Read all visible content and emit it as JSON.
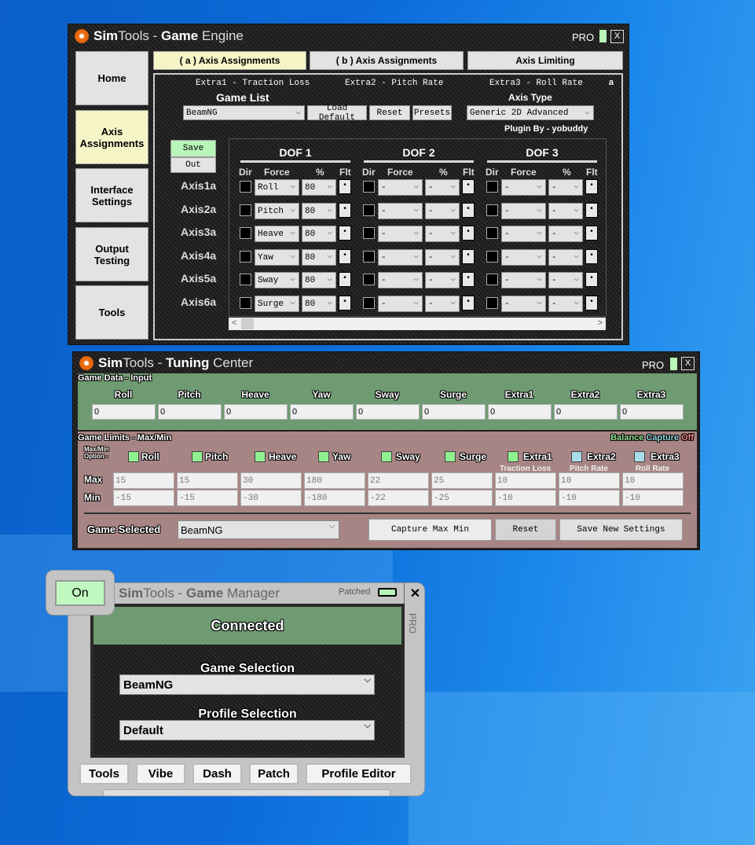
{
  "game_engine": {
    "title_bold1": "Sim",
    "title_reg1": "Tools - ",
    "title_bold2": "Game",
    "title_reg2": " Engine",
    "pro": "PRO",
    "close": "X",
    "sidebar": [
      {
        "label": "Home"
      },
      {
        "label": "Axis Assignments",
        "active": true
      },
      {
        "label": "Interface Settings"
      },
      {
        "label": "Output Testing"
      },
      {
        "label": "Tools"
      }
    ],
    "tabs": [
      {
        "label": "( a ) Axis Assignments",
        "active": true
      },
      {
        "label": "( b ) Axis Assignments"
      },
      {
        "label": "Axis Limiting"
      }
    ],
    "extras": [
      "Extra1 - Traction Loss",
      "Extra2 - Pitch Rate",
      "Extra3 - Roll Rate"
    ],
    "page_marker": "a",
    "game_list_label": "Game List",
    "game_list_value": "BeamNG",
    "load_default": "Load Default",
    "reset": "Reset",
    "presets": "Presets",
    "axis_type_label": "Axis Type",
    "axis_type_value": "Generic 2D Advanced",
    "plugin_by": "Plugin By - yobuddy",
    "save": "Save",
    "out": "Out",
    "dof_headers": [
      "DOF 1",
      "DOF 2",
      "DOF 3"
    ],
    "col_headers": {
      "dir": "Dir",
      "force": "Force",
      "pct": "%",
      "flt": "Flt"
    },
    "axes": [
      {
        "label": "Axis1a",
        "dof": [
          {
            "force": "Roll",
            "pct": "80"
          },
          {
            "force": "-",
            "pct": "-"
          },
          {
            "force": "-",
            "pct": "-"
          }
        ]
      },
      {
        "label": "Axis2a",
        "dof": [
          {
            "force": "Pitch",
            "pct": "80"
          },
          {
            "force": "-",
            "pct": "-"
          },
          {
            "force": "-",
            "pct": "-"
          }
        ]
      },
      {
        "label": "Axis3a",
        "dof": [
          {
            "force": "Heave",
            "pct": "80"
          },
          {
            "force": "-",
            "pct": "-"
          },
          {
            "force": "-",
            "pct": "-"
          }
        ]
      },
      {
        "label": "Axis4a",
        "dof": [
          {
            "force": "Yaw",
            "pct": "80"
          },
          {
            "force": "-",
            "pct": "-"
          },
          {
            "force": "-",
            "pct": "-"
          }
        ]
      },
      {
        "label": "Axis5a",
        "dof": [
          {
            "force": "Sway",
            "pct": "80"
          },
          {
            "force": "-",
            "pct": "-"
          },
          {
            "force": "-",
            "pct": "-"
          }
        ]
      },
      {
        "label": "Axis6a",
        "dof": [
          {
            "force": "Surge",
            "pct": "80"
          },
          {
            "force": "-",
            "pct": "-"
          },
          {
            "force": "-",
            "pct": "-"
          }
        ]
      }
    ],
    "flt_glyph": "•",
    "scroll_left": "<",
    "scroll_right": ">"
  },
  "tuning_center": {
    "title_bold1": "Sim",
    "title_reg1": "Tools - ",
    "title_bold2": "Tuning",
    "title_reg2": " Center",
    "pro": "PRO",
    "close": "X",
    "input_section": "Game Data - Input",
    "inputs": [
      {
        "label": "Roll",
        "value": "0"
      },
      {
        "label": "Pitch",
        "value": "0"
      },
      {
        "label": "Heave",
        "value": "0"
      },
      {
        "label": "Yaw",
        "value": "0"
      },
      {
        "label": "Sway",
        "value": "0"
      },
      {
        "label": "Surge",
        "value": "0"
      },
      {
        "label": "Extra1",
        "value": "0"
      },
      {
        "label": "Extra2",
        "value": "0"
      },
      {
        "label": "Extra3",
        "value": "0"
      }
    ],
    "limits_section": "Game Limits - Max/Min",
    "balance": "Balance",
    "capture": "Capture",
    "off": "Off",
    "option_label": "Max/Min Option -",
    "max_label": "Max",
    "min_label": "Min",
    "limits": [
      {
        "label": "Roll",
        "color": "#90f090",
        "max": "15",
        "min": "-15"
      },
      {
        "label": "Pitch",
        "color": "#90f090",
        "max": "15",
        "min": "-15"
      },
      {
        "label": "Heave",
        "color": "#90f090",
        "max": "30",
        "min": "-30"
      },
      {
        "label": "Yaw",
        "color": "#90f090",
        "max": "180",
        "min": "-180"
      },
      {
        "label": "Sway",
        "color": "#90f090",
        "max": "22",
        "min": "-22"
      },
      {
        "label": "Surge",
        "color": "#90f090",
        "max": "25",
        "min": "-25"
      },
      {
        "label": "Extra1",
        "color": "#90f090",
        "sub": "Traction Loss",
        "max": "10",
        "min": "-10"
      },
      {
        "label": "Extra2",
        "color": "#a8dce8",
        "sub": "Pitch Rate",
        "max": "10",
        "min": "-10"
      },
      {
        "label": "Extra3",
        "color": "#a8dce8",
        "sub": "Roll Rate",
        "max": "10",
        "min": "-10"
      }
    ],
    "game_selected_label": "Game Selected",
    "game_selected_value": "BeamNG",
    "capture_btn": "Capture Max Min",
    "reset_btn": "Reset",
    "save_btn": "Save New Settings"
  },
  "game_manager": {
    "on": "On",
    "title_bold1": "Sim",
    "title_reg1": "Tools - ",
    "title_bold2": "Game",
    "title_reg2": " Manager",
    "patched": "Patched",
    "close": "✕",
    "pro": "PRO",
    "status": "Connected",
    "game_selection_label": "Game Selection",
    "game_selection_value": "BeamNG",
    "profile_selection_label": "Profile Selection",
    "profile_selection_value": "Default",
    "buttons": [
      "Tools",
      "Vibe",
      "Dash",
      "Patch",
      "Profile Editor"
    ]
  }
}
